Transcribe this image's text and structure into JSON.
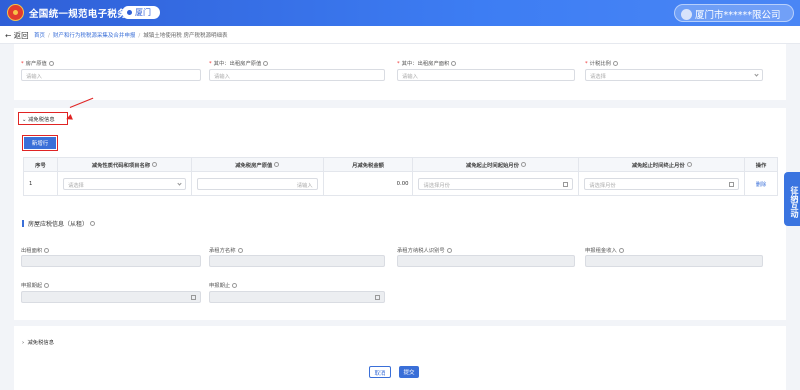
{
  "header": {
    "site_title": "全国统一规范电子税务局",
    "city": "厦门",
    "user": "厦门市******限公司"
  },
  "nav": {
    "back": "返回",
    "breadcrumbs": [
      "首页",
      "财产和行为税税源采集及合并申报",
      "城镇土地使用税 房产税税源明细表"
    ]
  },
  "top_form": {
    "fields": [
      {
        "label": "房产原值",
        "placeholder": "请输入",
        "required": true
      },
      {
        "label": "其中：出租房产原值",
        "placeholder": "请输入",
        "required": true
      },
      {
        "label": "其中：出租房产面积",
        "placeholder": "请输入",
        "required": true
      },
      {
        "label": "计税比例",
        "placeholder": "请选择",
        "required": true
      }
    ]
  },
  "reduction_section": {
    "title": "减免税信息",
    "add_button": "新增行",
    "columns": [
      "序号",
      "减免性质代码和项目名称",
      "减免税房产原值",
      "月减免税金额",
      "减免起止时间起始月份",
      "减免起止时间终止月份",
      "操作"
    ],
    "rows": [
      {
        "index": "1",
        "code_placeholder": "请选择",
        "value_placeholder": "请输入",
        "monthly_amount": "0.00",
        "start_placeholder": "请选择月份",
        "end_placeholder": "请选择月份",
        "action": "删除"
      }
    ]
  },
  "rental_section": {
    "title": "房屋应税信息（从租）",
    "fields_row1": [
      "出租面积",
      "承租方名称",
      "承租方纳税人识别号",
      "申报租金收入"
    ],
    "fields_row2": [
      "申报期起",
      "申报期止"
    ]
  },
  "collapsed_section": {
    "title": "减免税信息"
  },
  "footer": {
    "cancel": "取消",
    "submit": "提交"
  },
  "float_widget": {
    "label": "征纳互动"
  },
  "colors": {
    "primary": "#3a6fd8",
    "header": "#2f5fd7",
    "highlight": "#e02424"
  }
}
